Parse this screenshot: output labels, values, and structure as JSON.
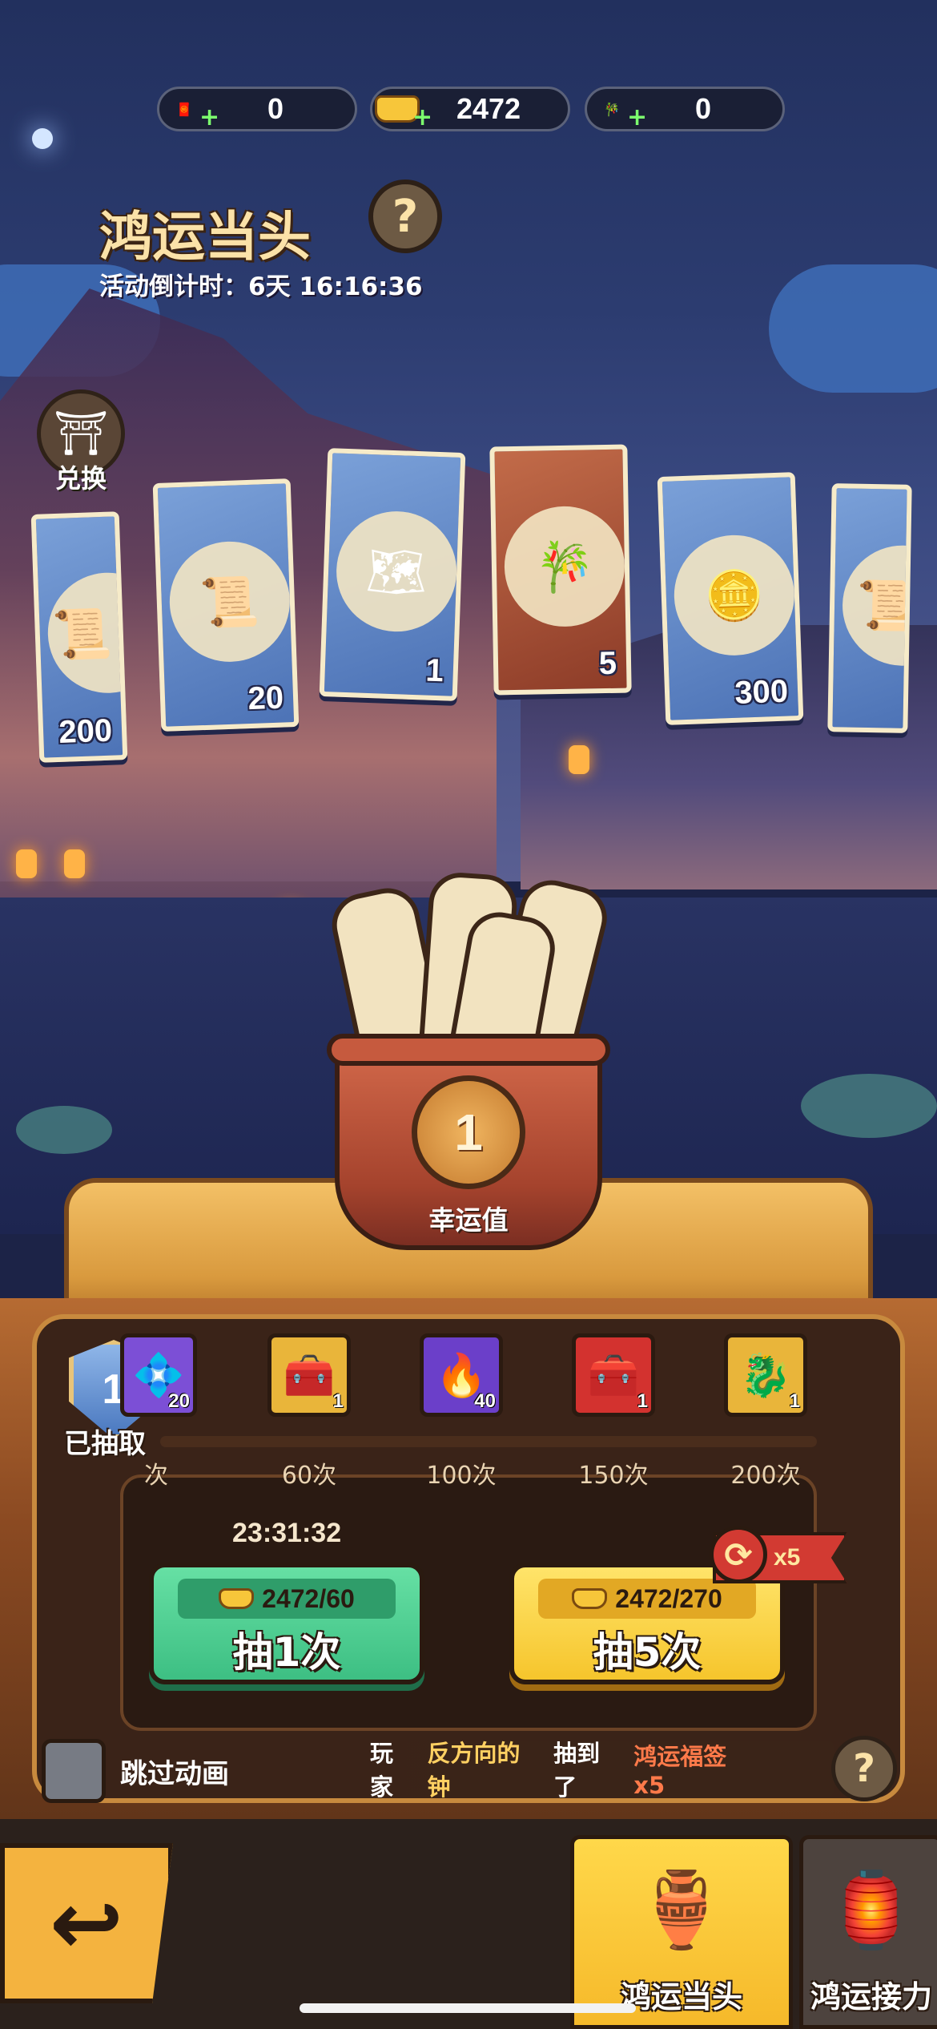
{
  "currencies": [
    {
      "icon": "red-envelope-icon",
      "value": "0"
    },
    {
      "icon": "gold-ingot-icon",
      "value": "2472"
    },
    {
      "icon": "fortune-sticks-icon",
      "value": "0"
    }
  ],
  "header": {
    "title": "鸿运当头",
    "countdown": "活动倒计时：6天 16:16:36"
  },
  "exchange_label": "兑换",
  "reward_cards": [
    {
      "icon": "mystery-scroll-icon",
      "glyph": "📜",
      "amount": "200",
      "special": false
    },
    {
      "icon": "mystery-scroll-icon",
      "glyph": "📜",
      "amount": "20",
      "special": false
    },
    {
      "icon": "map-scroll-icon",
      "glyph": "🗺",
      "amount": "1",
      "special": false
    },
    {
      "icon": "fortune-sticks-icon",
      "glyph": "🀄",
      "amount": "5",
      "special": true
    },
    {
      "icon": "copper-coin-icon",
      "glyph": "🪙",
      "amount": "300",
      "special": false
    },
    {
      "icon": "scroll-icon",
      "glyph": "📜",
      "amount": "",
      "special": false
    }
  ],
  "luck": {
    "value": "1",
    "label": "幸运值"
  },
  "milestones": {
    "claimed_count": "1",
    "claimed_label": "已抽取",
    "items": [
      {
        "icon": "purple-reward-icon",
        "glyph": "💠",
        "amount": "20",
        "label": "次",
        "bg": "#7c4fd6"
      },
      {
        "icon": "hero-chest-gold-icon",
        "glyph": "🧰",
        "amount": "1",
        "label": "60次",
        "bg": "#e9b53a"
      },
      {
        "icon": "fire-orb-icon",
        "glyph": "🔥",
        "amount": "40",
        "label": "100次",
        "bg": "#6b3fc9"
      },
      {
        "icon": "hero-chest-red-icon",
        "glyph": "🧰",
        "amount": "1",
        "label": "150次",
        "bg": "#d3322f"
      },
      {
        "icon": "dragon-hero-icon",
        "glyph": "🐉",
        "amount": "1",
        "label": "200次",
        "bg": "#e9b53a"
      }
    ]
  },
  "timer": "23:31:32",
  "draw_buttons": {
    "single": {
      "cost": "2472/60",
      "label": "抽1次"
    },
    "multi": {
      "cost": "2472/270",
      "label": "抽5次"
    },
    "bonus": "x5"
  },
  "skip_animation_label": "跳过动画",
  "broadcast": {
    "prefix": "玩家",
    "player": "反方向的钟",
    "middle": "抽到了",
    "reward": "鸿运福签x5"
  },
  "tabs": [
    {
      "label": "鸿运当头",
      "icon": "fortune-pot-icon",
      "glyph": "🏺",
      "active": true
    },
    {
      "label": "鸿运接力",
      "icon": "relay-badge-icon",
      "glyph": "🏮",
      "active": false
    }
  ],
  "colors": {
    "accent_gold": "#f6c52c",
    "accent_green": "#3dbf83",
    "accent_red": "#d23a32"
  }
}
